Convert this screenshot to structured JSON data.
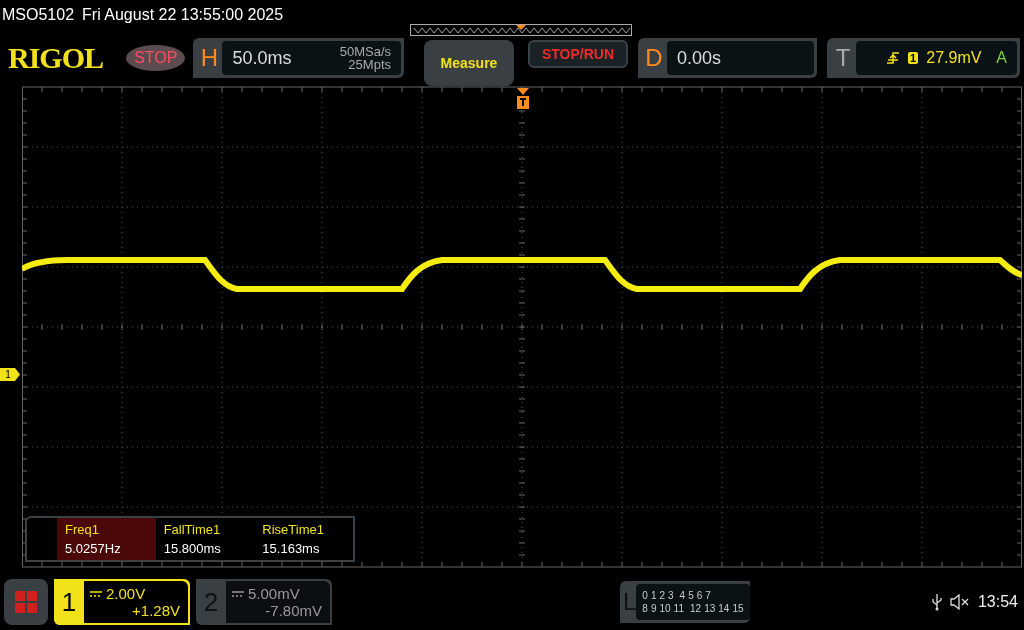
{
  "header": {
    "model": "MSO5102",
    "datetime": "Fri August 22 13:55:00 2025"
  },
  "toolbar": {
    "logo": "RIGOL",
    "run_state": "STOP",
    "horizontal": {
      "letter": "H",
      "timebase": "50.0ms",
      "sample_rate": "50MSa/s",
      "memory_depth": "25Mpts"
    },
    "buttons": [
      {
        "label": "Measure",
        "kind": "menu"
      },
      {
        "label": "STOP/RUN",
        "kind": "control"
      }
    ],
    "delay": {
      "letter": "D",
      "value": "0.00s"
    },
    "trigger": {
      "letter": "T",
      "source": "1",
      "level": "27.9mV",
      "mode": "A"
    }
  },
  "channel_marker": "1",
  "measurements": [
    {
      "name": "Freq1",
      "value": "5.0257Hz",
      "selected": true
    },
    {
      "name": "FallTime1",
      "value": "15.800ms",
      "selected": false
    },
    {
      "name": "RiseTime1",
      "value": "15.163ms",
      "selected": false
    }
  ],
  "channels": [
    {
      "number": "1",
      "scale": "2.00V",
      "offset": "+1.28V",
      "selected": true
    },
    {
      "number": "2",
      "scale": "5.00mV",
      "offset": "-7.80mV",
      "selected": false
    }
  ],
  "logic": {
    "letter": "L",
    "rows": [
      [
        [
          "0",
          "1",
          "2",
          "3"
        ],
        [
          "4",
          "5",
          "6",
          "7"
        ]
      ],
      [
        [
          "8",
          "9",
          "10",
          "11"
        ],
        [
          "12",
          "13",
          "14",
          "15"
        ]
      ]
    ]
  },
  "status": {
    "time": "13:54"
  }
}
